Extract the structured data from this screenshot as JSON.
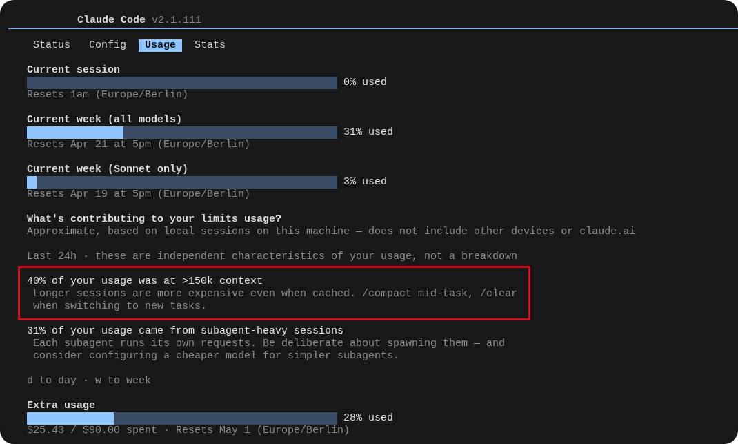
{
  "window": {
    "title": "Claude Code",
    "version": "v2.1.111"
  },
  "tabs": [
    {
      "label": "Status",
      "selected": false
    },
    {
      "label": "Config",
      "selected": false
    },
    {
      "label": "Usage",
      "selected": true
    },
    {
      "label": "Stats",
      "selected": false
    }
  ],
  "limits": [
    {
      "title": "Current session",
      "level": 0,
      "reading": "0% used",
      "resets": "Resets 1am (Europe/Berlin)"
    },
    {
      "title": "Current week (all models)",
      "level": 0.31,
      "reading": "31% used",
      "resets": "Resets Apr 21 at 5pm (Europe/Berlin)"
    },
    {
      "title": "Current week (Sonnet only)",
      "level": 0.03,
      "reading": "3% used",
      "resets": "Resets Apr 19 at 5pm (Europe/Berlin)"
    }
  ],
  "contributions": {
    "heading": "What's contributing to your limits usage?",
    "note": "Approximate, based on local sessions on this machine — does not include other devices or claude.ai",
    "period": "Last 24h · these are independent characteristics of your usage, not a breakdown",
    "items": [
      {
        "headline": "40% of your usage was at >150k context",
        "detail": "Longer sessions are more expensive even when cached. /compact mid-task, /clear when switching to new tasks.",
        "highlighted": true
      },
      {
        "headline": "31% of your usage came from subagent-heavy sessions",
        "detail": "Each subagent runs its own requests. Be deliberate about spawning them — and consider configuring a cheaper model for simpler subagents.",
        "highlighted": false
      }
    ],
    "key_hint": "d to day · w to week"
  },
  "extra_usage": {
    "title": "Extra usage",
    "level": 0.28,
    "reading": "28% used",
    "detail": "$25.43 / $90.00 spent · Resets May 1 (Europe/Berlin)"
  }
}
